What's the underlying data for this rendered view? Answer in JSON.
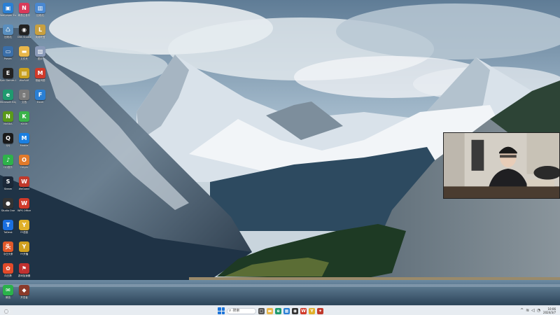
{
  "desktop": {
    "columns": [
      [
        {
          "name": "Wallpaper Engine",
          "icon": "monitor-icon",
          "glyph": "▣",
          "color": "#2a7fd4"
        },
        {
          "name": "回收站",
          "icon": "recycle-bin-icon",
          "glyph": "♺",
          "color": "#5a8fbf"
        },
        {
          "name": "Parsec",
          "icon": "parsec-icon",
          "glyph": "▭",
          "color": "#3a6ea8"
        },
        {
          "name": "Epic Games Launcher",
          "icon": "epic-games-icon",
          "glyph": "E",
          "color": "#222222"
        },
        {
          "name": "Microsoft Edge",
          "icon": "edge-icon",
          "glyph": "e",
          "color": "#1f9a6f"
        },
        {
          "name": "NVIDIA",
          "icon": "nvidia-icon",
          "glyph": "N",
          "color": "#5a9a1a"
        },
        {
          "name": "QQ",
          "icon": "qq-icon",
          "glyph": "Q",
          "color": "#1a1a1a"
        },
        {
          "name": "QQ音乐",
          "icon": "qq-music-icon",
          "glyph": "♪",
          "color": "#2eb24a"
        },
        {
          "name": "Steam",
          "icon": "steam-icon",
          "glyph": "S",
          "color": "#1b2838"
        },
        {
          "name": "Studio One",
          "icon": "studio-one-icon",
          "glyph": "●",
          "color": "#333333"
        },
        {
          "name": "ToDesk",
          "icon": "todesk-icon",
          "glyph": "T",
          "color": "#1a6fe0"
        },
        {
          "name": "今日头条",
          "icon": "toutiao-icon",
          "glyph": "头",
          "color": "#e0592a"
        },
        {
          "name": "向日葵",
          "icon": "sunlogin-icon",
          "glyph": "✿",
          "color": "#e04a2a"
        },
        {
          "name": "微信",
          "icon": "wechat-icon",
          "glyph": "✉",
          "color": "#2ab24a"
        },
        {
          "name": "设置",
          "icon": "settings-icon",
          "glyph": "⚙",
          "color": "#555555"
        }
      ],
      [
        {
          "name": "网易云音乐",
          "icon": "netease-music-icon",
          "glyph": "N",
          "color": "#d93a5a"
        },
        {
          "name": "OBS Studio",
          "icon": "obs-icon",
          "glyph": "◉",
          "color": "#222222"
        },
        {
          "name": "文件夹",
          "icon": "folder-icon",
          "glyph": "▬",
          "color": "#e8b64a"
        },
        {
          "name": "WinRAR",
          "icon": "winrar-icon",
          "glyph": "▤",
          "color": "#c8a020"
        },
        {
          "name": "文档",
          "icon": "document-icon",
          "glyph": "▯",
          "color": "#7a7a7a"
        },
        {
          "name": "KOOK",
          "icon": "kook-icon",
          "glyph": "K",
          "color": "#3ab24a"
        },
        {
          "name": "Mobile",
          "icon": "mobile-icon",
          "glyph": "M",
          "color": "#1a7fe0"
        },
        {
          "name": "Origin",
          "icon": "origin-icon",
          "glyph": "O",
          "color": "#e07a2a"
        },
        {
          "name": "WeGame",
          "icon": "wegame-icon",
          "glyph": "W",
          "color": "#c0392b"
        },
        {
          "name": "WPS Office",
          "icon": "wps-icon",
          "glyph": "W",
          "color": "#d03a2a"
        },
        {
          "name": "YY语音",
          "icon": "yy-icon",
          "glyph": "Y",
          "color": "#e0b02a"
        },
        {
          "name": "YY开播",
          "icon": "yy-live-icon",
          "glyph": "Y",
          "color": "#d0a020"
        },
        {
          "name": "游戏加速器",
          "icon": "accelerator-icon",
          "glyph": "⚑",
          "color": "#c03030"
        },
        {
          "name": "开发者",
          "icon": "developer-icon",
          "glyph": "◆",
          "color": "#8a3a2a"
        }
      ],
      [
        {
          "name": "回收站",
          "icon": "recycle-icon",
          "glyph": "▥",
          "color": "#4a88d0"
        },
        {
          "name": "英雄联盟",
          "icon": "lol-icon",
          "glyph": "L",
          "color": "#c8a040"
        },
        {
          "name": "图片",
          "icon": "image-icon",
          "glyph": "▧",
          "color": "#8a9ab8"
        },
        {
          "name": "超级玛丽",
          "icon": "game-icon",
          "glyph": "M",
          "color": "#d03a2a"
        },
        {
          "name": "Excel",
          "icon": "excel-icon",
          "glyph": "F",
          "color": "#2a7fd4"
        }
      ]
    ]
  },
  "taskbar": {
    "search_placeholder": "搜索",
    "search_icon": "search-icon",
    "start_icon": "windows-start-icon",
    "widgets_icon": "widgets-icon",
    "apps": [
      {
        "name": "task-view",
        "glyph": "▢",
        "color": "#555555"
      },
      {
        "name": "file-explorer",
        "glyph": "▬",
        "color": "#e8b64a"
      },
      {
        "name": "edge",
        "glyph": "e",
        "color": "#1f9a6f"
      },
      {
        "name": "store",
        "glyph": "▦",
        "color": "#2a7fd4"
      },
      {
        "name": "obs",
        "glyph": "◉",
        "color": "#333333"
      },
      {
        "name": "wps",
        "glyph": "W",
        "color": "#d03a2a"
      },
      {
        "name": "yy",
        "glyph": "Y",
        "color": "#e0b02a"
      },
      {
        "name": "wegame",
        "glyph": "✦",
        "color": "#c0392b"
      }
    ],
    "tray": [
      {
        "name": "chevron-up-icon",
        "glyph": "^"
      },
      {
        "name": "wifi-icon",
        "glyph": "≋"
      },
      {
        "name": "volume-icon",
        "glyph": "◁"
      },
      {
        "name": "notification-icon",
        "glyph": "◔"
      }
    ],
    "clock": {
      "time": "10:06",
      "date": "2024/3/7"
    }
  },
  "webcam": {
    "label": "webcam-overlay"
  }
}
